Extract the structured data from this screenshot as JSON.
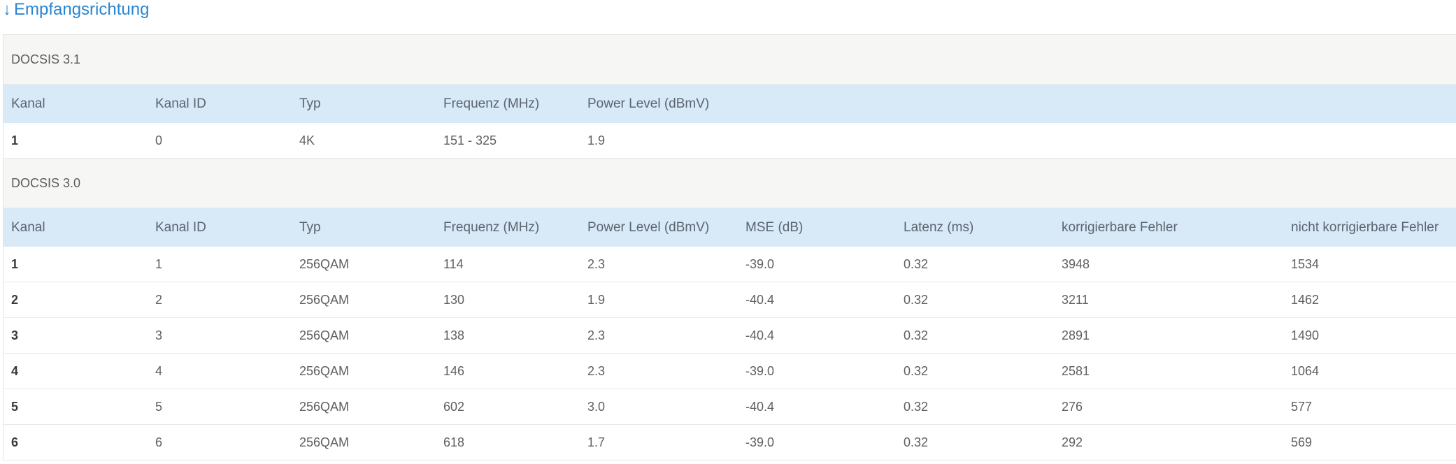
{
  "heading": {
    "arrow": "↓",
    "title": "Empfangsrichtung"
  },
  "docsis31": {
    "group_label": "DOCSIS 3.1",
    "columns": [
      "Kanal",
      "Kanal ID",
      "Typ",
      "Frequenz (MHz)",
      "Power Level (dBmV)"
    ],
    "rows": [
      [
        "1",
        "0",
        "4K",
        "151 - 325",
        "1.9"
      ]
    ]
  },
  "docsis30": {
    "group_label": "DOCSIS 3.0",
    "columns": [
      "Kanal",
      "Kanal ID",
      "Typ",
      "Frequenz (MHz)",
      "Power Level (dBmV)",
      "MSE (dB)",
      "Latenz (ms)",
      "korrigierbare Fehler",
      "nicht korrigierbare Fehler"
    ],
    "rows": [
      [
        "1",
        "1",
        "256QAM",
        "114",
        "2.3",
        "-39.0",
        "0.32",
        "3948",
        "1534"
      ],
      [
        "2",
        "2",
        "256QAM",
        "130",
        "1.9",
        "-40.4",
        "0.32",
        "3211",
        "1462"
      ],
      [
        "3",
        "3",
        "256QAM",
        "138",
        "2.3",
        "-40.4",
        "0.32",
        "2891",
        "1490"
      ],
      [
        "4",
        "4",
        "256QAM",
        "146",
        "2.3",
        "-39.0",
        "0.32",
        "2581",
        "1064"
      ],
      [
        "5",
        "5",
        "256QAM",
        "602",
        "3.0",
        "-40.4",
        "0.32",
        "276",
        "577"
      ],
      [
        "6",
        "6",
        "256QAM",
        "618",
        "1.7",
        "-39.0",
        "0.32",
        "292",
        "569"
      ]
    ]
  }
}
